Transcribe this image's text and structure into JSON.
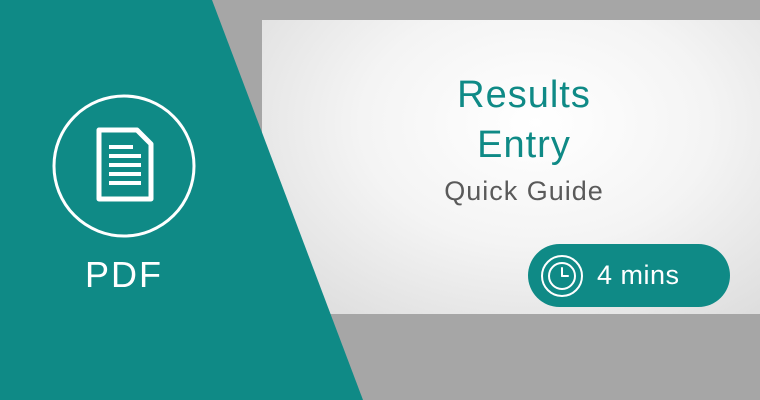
{
  "title_line_1": "Results",
  "title_line_2": "Entry",
  "subtitle": "Quick Guide",
  "duration": "4 mins",
  "format": "PDF",
  "icons": {
    "document": "document-icon",
    "clock": "clock-icon"
  },
  "colors": {
    "teal": "#0f8a86",
    "background_gray": "#a6a6a6",
    "card_white": "#ffffff",
    "subtitle_gray": "#5a5a5a"
  }
}
